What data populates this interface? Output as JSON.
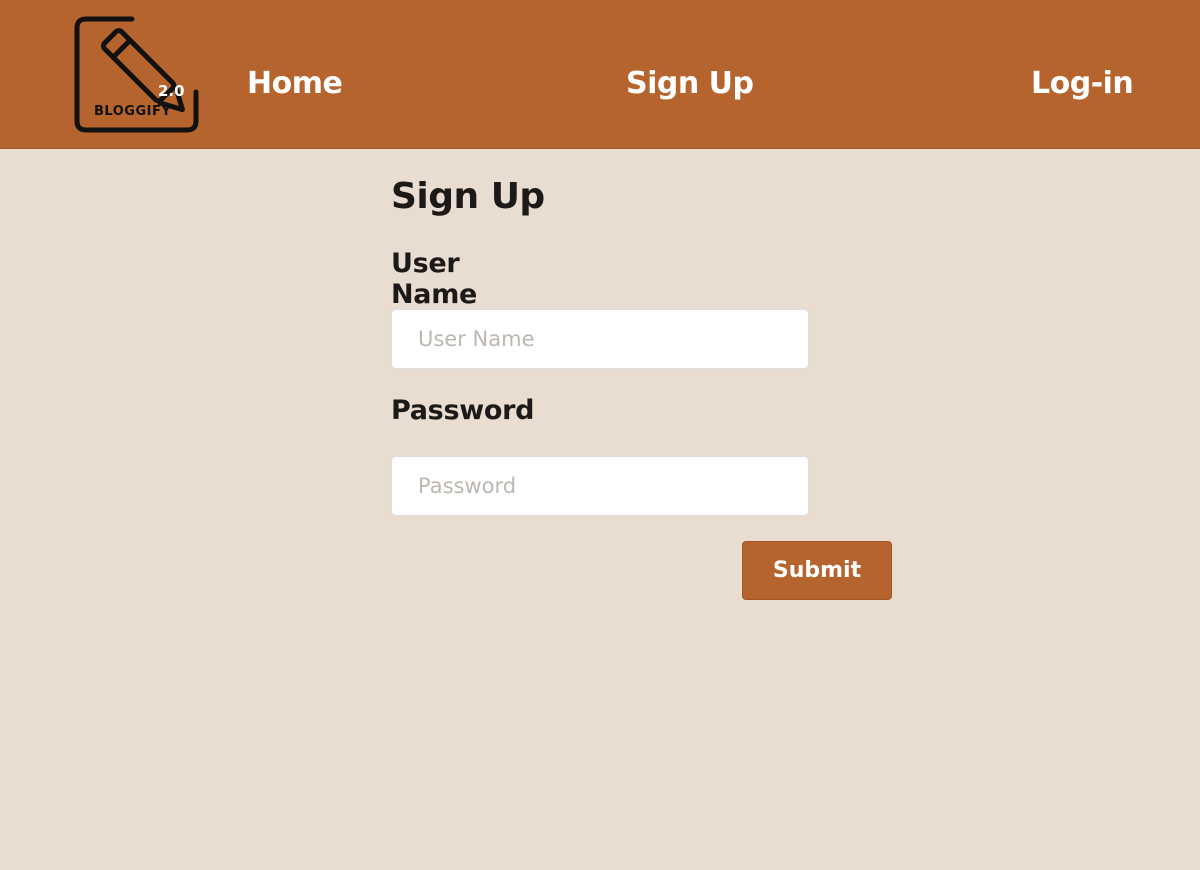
{
  "nav": {
    "logo": {
      "name": "BLOGGIFY",
      "version": "2.0"
    },
    "links": [
      {
        "label": "Home"
      },
      {
        "label": "Sign Up"
      },
      {
        "label": "Log-in"
      }
    ]
  },
  "form": {
    "title": "Sign Up",
    "username": {
      "label": "User Name",
      "placeholder": "User Name",
      "value": ""
    },
    "password": {
      "label": "Password",
      "placeholder": "Password",
      "value": ""
    },
    "submit_label": "Submit"
  },
  "colors": {
    "brand": "#b5642d",
    "background": "#e9dcd0"
  }
}
